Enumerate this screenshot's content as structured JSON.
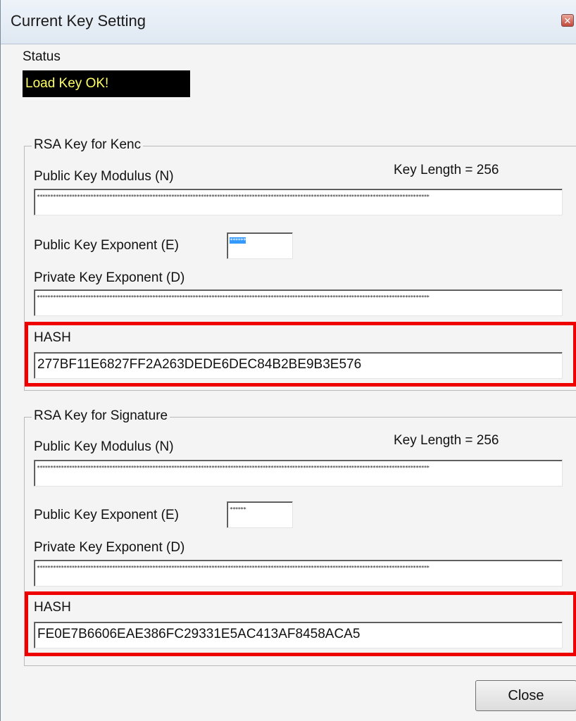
{
  "window": {
    "title": "Current Key Setting",
    "close_glyph": "✕"
  },
  "status": {
    "label": "Status",
    "value": "Load Key OK!"
  },
  "kenc": {
    "group_title": "RSA Key for Kenc",
    "modulus_label": "Public Key Modulus (N)",
    "key_length": "Key Length = 256",
    "modulus_value": "**************************************************************************************************************************************************",
    "exponent_e_label": "Public Key Exponent (E)",
    "exponent_e_value": "******",
    "exponent_d_label": "Private Key Exponent (D)",
    "exponent_d_value": "**************************************************************************************************************************************************",
    "hash_label": "HASH",
    "hash_value": "277BF11E6827FF2A263DEDE6DEC84B2BE9B3E576"
  },
  "signature": {
    "group_title": "RSA Key for Signature",
    "modulus_label": "Public Key Modulus (N)",
    "key_length": "Key Length = 256",
    "modulus_value": "**************************************************************************************************************************************************",
    "exponent_e_label": "Public Key Exponent (E)",
    "exponent_e_value": "******",
    "exponent_d_label": "Private Key Exponent (D)",
    "exponent_d_value": "**************************************************************************************************************************************************",
    "hash_label": "HASH",
    "hash_value": "FE0E7B6606EAE386FC29331E5AC413AF8458ACA5"
  },
  "buttons": {
    "close": "Close"
  },
  "colors": {
    "highlight": "#ee0000",
    "status_bg": "#000000",
    "status_text": "#ffff66",
    "selection": "#3399ff"
  }
}
